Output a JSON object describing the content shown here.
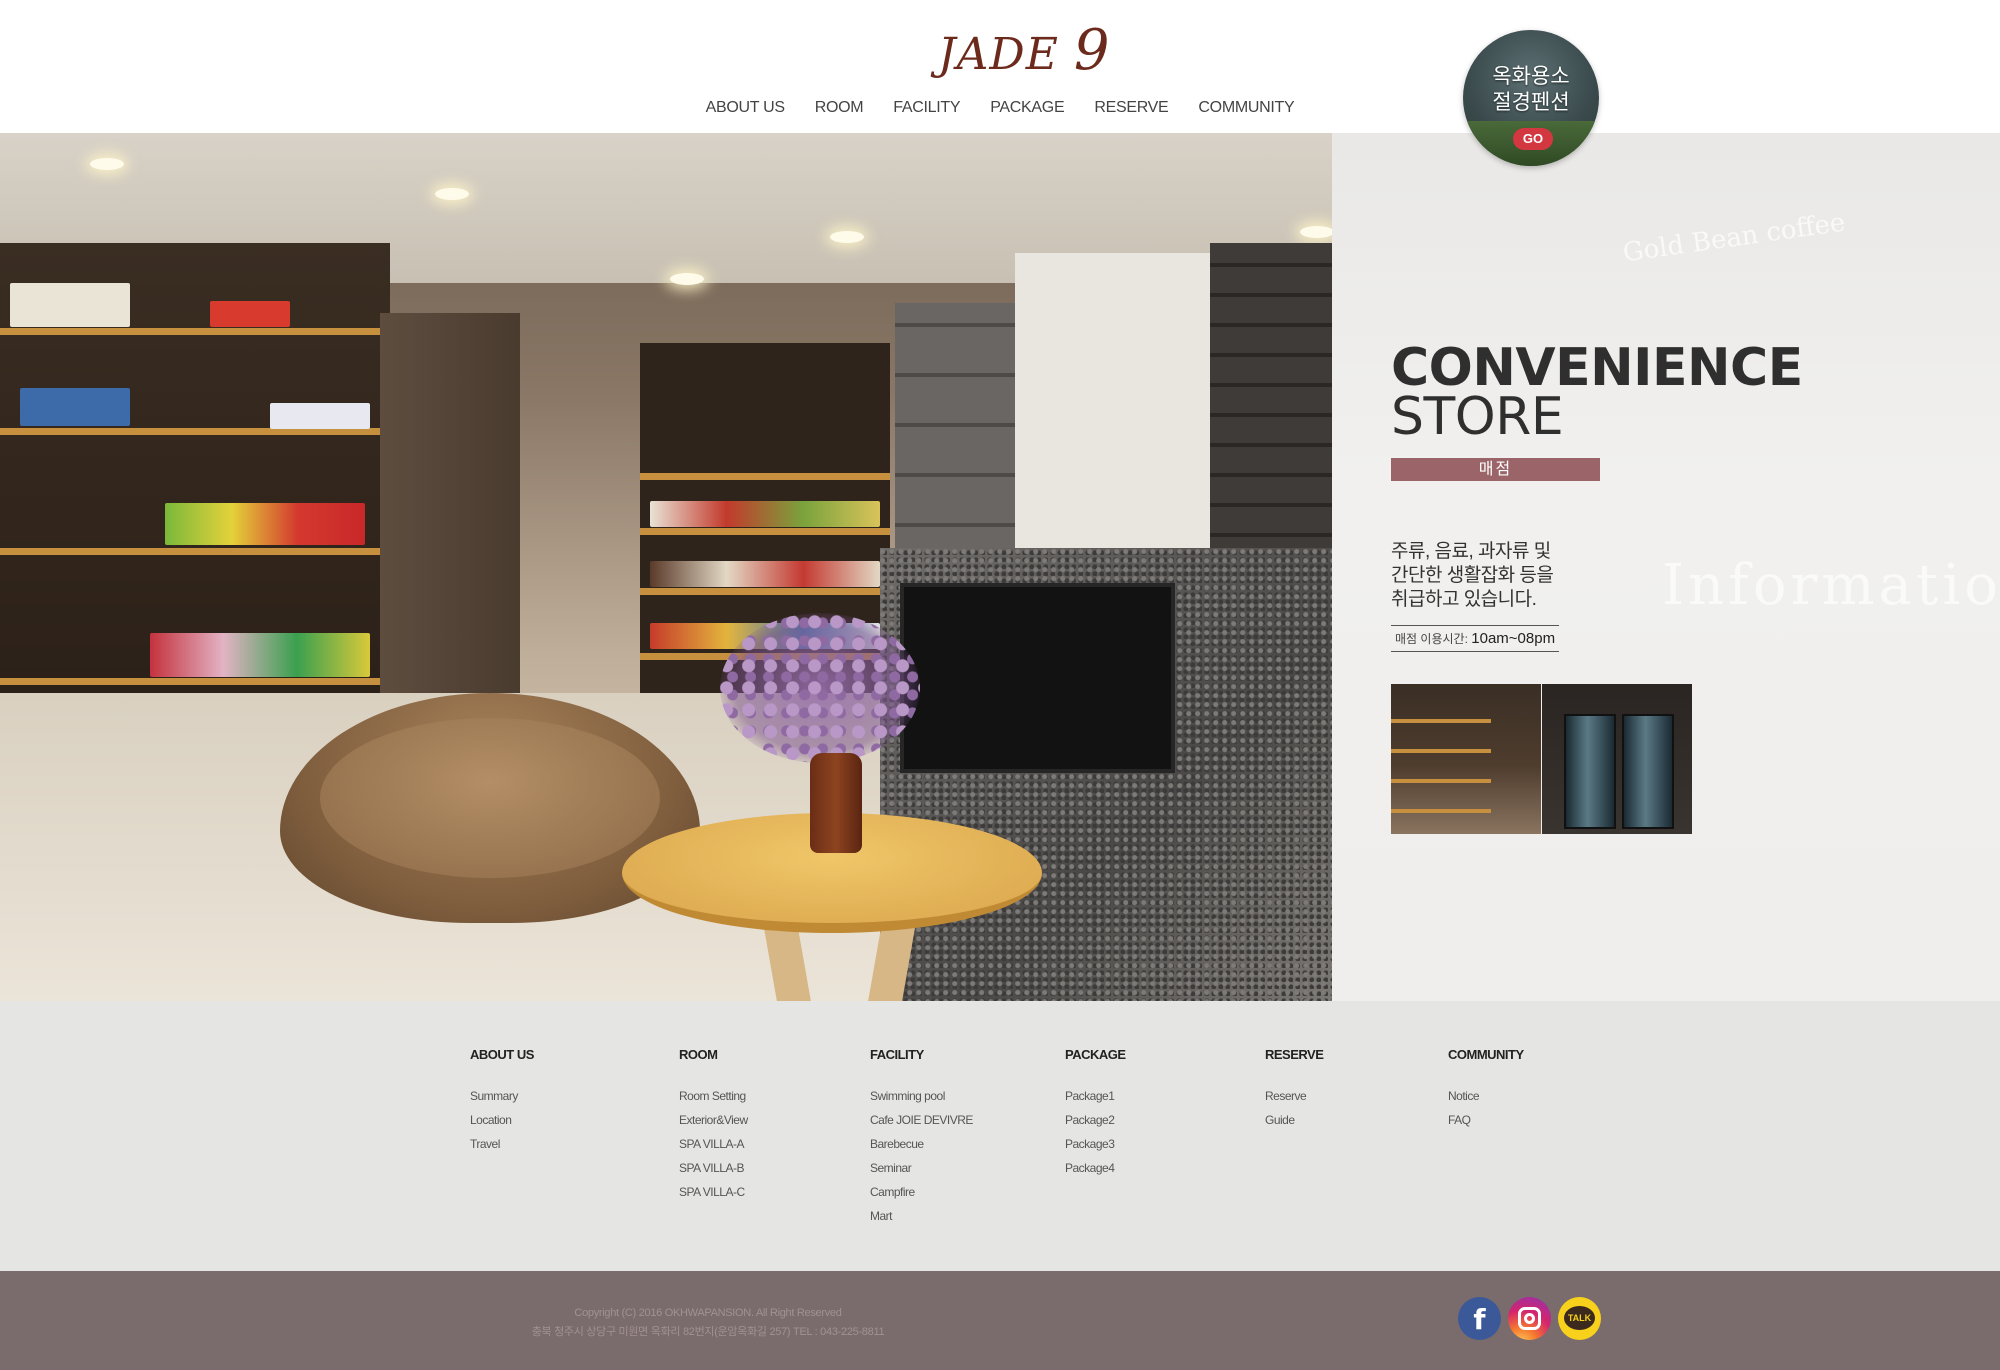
{
  "header": {
    "logo_text": "JADE",
    "logo_number": "9",
    "nav": [
      "ABOUT US",
      "ROOM",
      "FACILITY",
      "PACKAGE",
      "RESERVE",
      "COMMUNITY"
    ],
    "promo": {
      "line1": "옥화용소",
      "line2": "절경펜션",
      "button": "GO"
    }
  },
  "main": {
    "title_line1": "CONVENIENCE",
    "title_line2": "STORE",
    "subtitle": "매점",
    "description": [
      "주류, 음료, 과자류 및",
      "간단한 생활잡화 등을",
      "취급하고 있습니다."
    ],
    "hours_label": "매점 이용시간:",
    "hours_value": "10am~08pm",
    "watermark": "Information",
    "accent_color": "#9a6468"
  },
  "footer": {
    "columns": [
      {
        "title": "ABOUT US",
        "links": [
          "Summary",
          "Location",
          "Travel"
        ]
      },
      {
        "title": "ROOM",
        "links": [
          "Room Setting",
          "Exterior&View",
          "SPA VILLA-A",
          "SPA VILLA-B",
          "SPA VILLA-C"
        ]
      },
      {
        "title": "FACILITY",
        "links": [
          "Swimming pool",
          "Cafe JOIE DEVIVRE",
          "Barebecue",
          "Seminar",
          "Campfire",
          "Mart"
        ]
      },
      {
        "title": "PACKAGE",
        "links": [
          "Package1",
          "Package2",
          "Package3",
          "Package4"
        ]
      },
      {
        "title": "RESERVE",
        "links": [
          "Reserve",
          "Guide"
        ]
      },
      {
        "title": "COMMUNITY",
        "links": [
          "Notice",
          "FAQ"
        ]
      }
    ],
    "copyright": "Copyright (C) 2016 OKHWAPANSION. All Right Reserved",
    "address": "충북 청주시 상당구 미원면 옥화리 82번지(운암옥화길 257) TEL : 043-225-8811",
    "social": {
      "facebook": "f",
      "kakao": "TALK"
    },
    "bar_color": "#7a6b6d"
  }
}
